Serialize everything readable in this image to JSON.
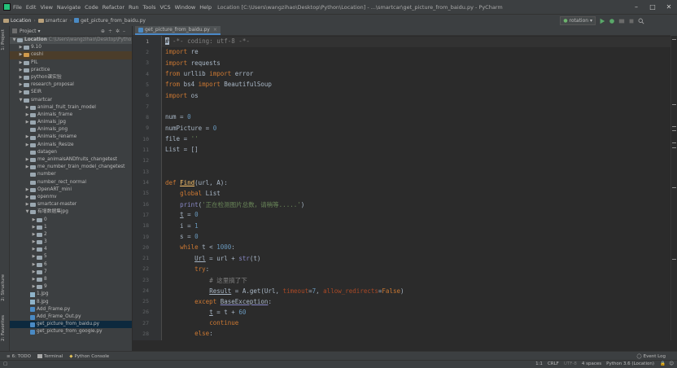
{
  "menubar": {
    "items": [
      "File",
      "Edit",
      "View",
      "Navigate",
      "Code",
      "Refactor",
      "Run",
      "Tools",
      "VCS",
      "Window",
      "Help"
    ],
    "window_title": "Location [C:\\Users\\wangzihao\\Desktop\\Python\\Location] - ...\\smartcar\\get_picture_from_baidu.py - PyCharm"
  },
  "navbar": {
    "crumbs": [
      "Location",
      "smartcar",
      "get_picture_from_baidu.py"
    ],
    "run_config": "rotation"
  },
  "left_tabs": [
    "1: Project",
    "2: Structure",
    "2: Favorites"
  ],
  "project": {
    "header": "Project",
    "tree": [
      {
        "label": "Location",
        "path": "C:\\Users\\wangzihao\\Desktop\\Pytho",
        "indent": 0,
        "arrow": "down",
        "kind": "root"
      },
      {
        "label": "9.10",
        "indent": 1,
        "arrow": "right",
        "kind": "folder"
      },
      {
        "label": "ceshi",
        "indent": 1,
        "arrow": "right",
        "kind": "folder-orange"
      },
      {
        "label": "PIL",
        "indent": 1,
        "arrow": "right",
        "kind": "folder"
      },
      {
        "label": "practice",
        "indent": 1,
        "arrow": "right",
        "kind": "folder"
      },
      {
        "label": "python课实验",
        "indent": 1,
        "arrow": "right",
        "kind": "folder"
      },
      {
        "label": "research_proposal",
        "indent": 1,
        "arrow": "right",
        "kind": "folder"
      },
      {
        "label": "SEIR",
        "indent": 1,
        "arrow": "right",
        "kind": "folder"
      },
      {
        "label": "smartcar",
        "indent": 1,
        "arrow": "down",
        "kind": "folder"
      },
      {
        "label": "animal_fruit_train_model",
        "indent": 2,
        "arrow": "right",
        "kind": "folder"
      },
      {
        "label": "Animals_frame",
        "indent": 2,
        "arrow": "right",
        "kind": "folder"
      },
      {
        "label": "Animals_jpg",
        "indent": 2,
        "arrow": "right",
        "kind": "folder"
      },
      {
        "label": "Animals_png",
        "indent": 2,
        "arrow": "",
        "kind": "folder"
      },
      {
        "label": "Animals_rename",
        "indent": 2,
        "arrow": "right",
        "kind": "folder"
      },
      {
        "label": "Animals_Resize",
        "indent": 2,
        "arrow": "right",
        "kind": "folder"
      },
      {
        "label": "datagen",
        "indent": 2,
        "arrow": "",
        "kind": "folder"
      },
      {
        "label": "me_animalsANDfruits_changetest",
        "indent": 2,
        "arrow": "right",
        "kind": "folder"
      },
      {
        "label": "me_number_train_model_changetest",
        "indent": 2,
        "arrow": "right",
        "kind": "folder"
      },
      {
        "label": "number",
        "indent": 2,
        "arrow": "",
        "kind": "folder"
      },
      {
        "label": "number_rect_normal",
        "indent": 2,
        "arrow": "",
        "kind": "folder"
      },
      {
        "label": "OpenART_mini",
        "indent": 2,
        "arrow": "right",
        "kind": "folder"
      },
      {
        "label": "openmv",
        "indent": 2,
        "arrow": "right",
        "kind": "folder"
      },
      {
        "label": "smartcar-master",
        "indent": 2,
        "arrow": "right",
        "kind": "folder"
      },
      {
        "label": "有增数据集jpg",
        "indent": 2,
        "arrow": "down",
        "kind": "folder"
      },
      {
        "label": "0",
        "indent": 3,
        "arrow": "right",
        "kind": "folder"
      },
      {
        "label": "1",
        "indent": 3,
        "arrow": "right",
        "kind": "folder"
      },
      {
        "label": "2",
        "indent": 3,
        "arrow": "right",
        "kind": "folder"
      },
      {
        "label": "3",
        "indent": 3,
        "arrow": "right",
        "kind": "folder"
      },
      {
        "label": "4",
        "indent": 3,
        "arrow": "right",
        "kind": "folder"
      },
      {
        "label": "5",
        "indent": 3,
        "arrow": "right",
        "kind": "folder"
      },
      {
        "label": "6",
        "indent": 3,
        "arrow": "right",
        "kind": "folder"
      },
      {
        "label": "7",
        "indent": 3,
        "arrow": "right",
        "kind": "folder"
      },
      {
        "label": "8",
        "indent": 3,
        "arrow": "right",
        "kind": "folder"
      },
      {
        "label": "9",
        "indent": 3,
        "arrow": "right",
        "kind": "folder"
      },
      {
        "label": "1.jpg",
        "indent": 2,
        "arrow": "",
        "kind": "image"
      },
      {
        "label": "8.jpg",
        "indent": 2,
        "arrow": "",
        "kind": "image"
      },
      {
        "label": "Add_Frame.py",
        "indent": 2,
        "arrow": "",
        "kind": "py"
      },
      {
        "label": "Add_Frame_Out.py",
        "indent": 2,
        "arrow": "",
        "kind": "py"
      },
      {
        "label": "get_picture_from_baidu.py",
        "indent": 2,
        "arrow": "",
        "kind": "py",
        "selected": true
      },
      {
        "label": "get_picture_from_google.py",
        "indent": 2,
        "arrow": "",
        "kind": "py"
      }
    ]
  },
  "editor": {
    "tab": "get_picture_from_baidu.py",
    "line_numbers": [
      "1",
      "2",
      "3",
      "4",
      "5",
      "6",
      "7",
      "8",
      "9",
      "10",
      "11",
      "12",
      "13",
      "14",
      "15",
      "16",
      "17",
      "18",
      "19",
      "20",
      "21",
      "22",
      "23",
      "24",
      "25",
      "26",
      "27",
      "28",
      "29"
    ]
  },
  "bottom_tools": [
    "6: TODO",
    "Terminal",
    "Python Console"
  ],
  "event_log": "Event Log",
  "status": {
    "position": "1:1",
    "line_sep": "CRLF",
    "encoding": "UTF-8",
    "indent": "4 spaces",
    "interpreter": "Python 3.6 (Location)"
  },
  "colors": {
    "background": "#2b2b2b",
    "panel": "#3c3f41",
    "keyword": "#cc7832",
    "string": "#6a8759",
    "number": "#6897bb",
    "function": "#ffc66d",
    "comment": "#808080"
  }
}
